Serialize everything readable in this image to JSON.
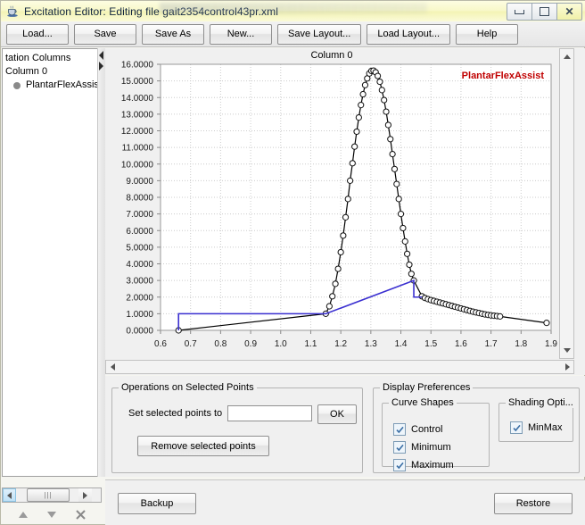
{
  "window": {
    "title": "Excitation Editor: Editing file gait2354control43pr.xml",
    "app_icon": "java-cup-icon",
    "minimize_label": "Minimize",
    "maximize_label": "Maximize",
    "close_label": "Close"
  },
  "toolbar": {
    "buttons": [
      {
        "label": "Load...",
        "name": "load-button"
      },
      {
        "label": "Save",
        "name": "save-button"
      },
      {
        "label": "Save As",
        "name": "save-as-button"
      },
      {
        "label": "New...",
        "name": "new-button"
      },
      {
        "label": "Save Layout...",
        "name": "save-layout-button"
      },
      {
        "label": "Load Layout...",
        "name": "load-layout-button"
      },
      {
        "label": "Help",
        "name": "help-button"
      }
    ]
  },
  "sidebar": {
    "tree": [
      {
        "label": "tation Columns",
        "level": 0
      },
      {
        "label": "Column 0",
        "level": 1
      },
      {
        "label": "PlantarFlexAssist",
        "level": 2
      }
    ],
    "scroll_left_arrow": "left-arrow",
    "scroll_right_arrow": "right-arrow",
    "tools": [
      "move-up-icon",
      "move-down-icon",
      "delete-icon"
    ]
  },
  "chart_data": {
    "type": "line",
    "title": "Column 0",
    "xlabel": "",
    "ylabel": "",
    "xlim": [
      0.6,
      1.9
    ],
    "ylim": [
      0.0,
      16.0
    ],
    "grid": true,
    "legend_position": "top-right",
    "xticks": [
      "0.6",
      "0.7",
      "0.8",
      "0.9",
      "1.0",
      "1.1",
      "1.2",
      "1.3",
      "1.4",
      "1.5",
      "1.6",
      "1.7",
      "1.8",
      "1.9"
    ],
    "yticks": [
      "0.0000",
      "1.0000",
      "2.0000",
      "3.0000",
      "4.0000",
      "5.0000",
      "6.0000",
      "7.0000",
      "8.0000",
      "9.0000",
      "10.0000",
      "11.0000",
      "12.0000",
      "13.0000",
      "14.0000",
      "15.0000",
      "16.0000"
    ],
    "series": [
      {
        "name": "PlantarFlexAssist",
        "color": "#000000",
        "marker": "open-circle",
        "x": [
          0.66,
          1.15,
          1.162,
          1.172,
          1.182,
          1.191,
          1.2,
          1.208,
          1.216,
          1.224,
          1.231,
          1.239,
          1.246,
          1.253,
          1.26,
          1.267,
          1.274,
          1.281,
          1.288,
          1.295,
          1.302,
          1.309,
          1.316,
          1.323,
          1.33,
          1.337,
          1.344,
          1.351,
          1.358,
          1.365,
          1.372,
          1.379,
          1.386,
          1.393,
          1.4,
          1.407,
          1.414,
          1.421,
          1.428,
          1.435,
          1.443,
          1.47,
          1.48,
          1.49,
          1.5,
          1.51,
          1.52,
          1.53,
          1.54,
          1.55,
          1.56,
          1.57,
          1.58,
          1.59,
          1.6,
          1.61,
          1.62,
          1.63,
          1.64,
          1.65,
          1.66,
          1.67,
          1.68,
          1.69,
          1.7,
          1.71,
          1.72,
          1.73,
          1.885
        ],
        "y": [
          0.0,
          1.0,
          1.45,
          2.05,
          2.8,
          3.7,
          4.7,
          5.7,
          6.8,
          7.9,
          9.0,
          10.05,
          11.05,
          11.95,
          12.8,
          13.55,
          14.2,
          14.75,
          15.15,
          15.45,
          15.6,
          15.62,
          15.52,
          15.3,
          14.95,
          14.45,
          13.85,
          13.15,
          12.35,
          11.5,
          10.6,
          9.7,
          8.8,
          7.9,
          7.0,
          6.15,
          5.35,
          4.6,
          3.95,
          3.4,
          3.0,
          2.05,
          1.95,
          1.88,
          1.82,
          1.77,
          1.72,
          1.67,
          1.62,
          1.57,
          1.52,
          1.47,
          1.42,
          1.37,
          1.32,
          1.27,
          1.22,
          1.17,
          1.12,
          1.08,
          1.04,
          1.0,
          0.96,
          0.93,
          0.9,
          0.88,
          0.86,
          0.84,
          0.45
        ]
      },
      {
        "name": "min-max-shading",
        "color": "#3a2fd0",
        "marker": "none",
        "x": [
          0.66,
          0.66,
          1.15,
          1.443,
          1.443,
          1.47
        ],
        "y": [
          0.0,
          1.0,
          1.0,
          3.0,
          2.0,
          2.0
        ]
      }
    ],
    "legend": [
      {
        "label": "PlantarFlexAssist",
        "color": "#c00000"
      }
    ]
  },
  "operations_panel": {
    "title": "Operations on Selected Points",
    "set_label": "Set selected points to",
    "set_value": "",
    "set_placeholder": "",
    "ok_label": "OK",
    "remove_label": "Remove selected points"
  },
  "display_panel": {
    "title": "Display Preferences",
    "curve_shapes": {
      "title": "Curve Shapes",
      "items": [
        {
          "label": "Control",
          "checked": true
        },
        {
          "label": "Minimum",
          "checked": true
        },
        {
          "label": "Maximum",
          "checked": true
        }
      ]
    },
    "shading_options": {
      "title": "Shading Opti...",
      "items": [
        {
          "label": "MinMax",
          "checked": true
        }
      ]
    }
  },
  "footer": {
    "backup_label": "Backup",
    "restore_label": "Restore"
  },
  "colors": {
    "titlebar": "#f6f6c4",
    "legend_red": "#c00000",
    "curve_blue": "#3a2fd0",
    "curve_black": "#000000"
  }
}
